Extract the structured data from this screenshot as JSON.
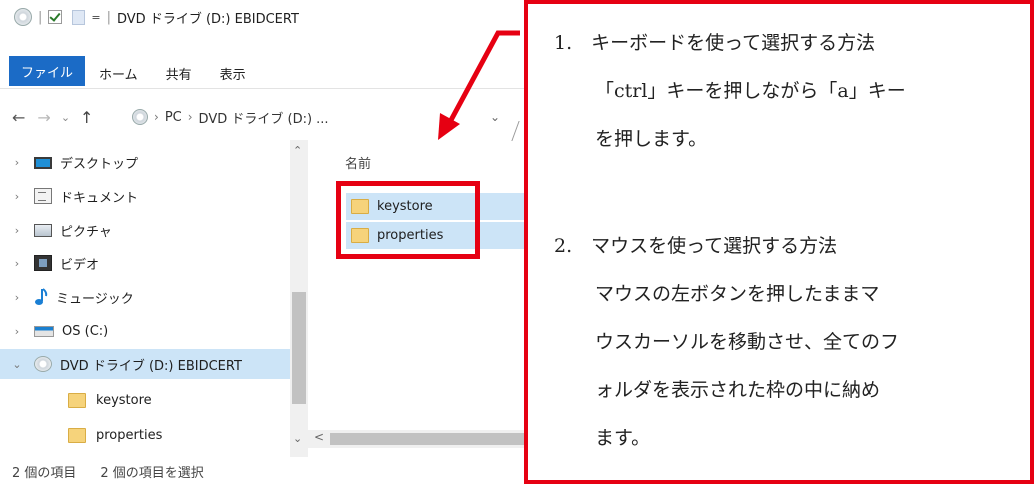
{
  "titlebar": {
    "title": "DVD ドライブ (D:) EBIDCERT",
    "sep": "|",
    "qa_arrow": "=",
    "icons": [
      "dvd-drive-icon",
      "properties-check-icon",
      "new-folder-icon",
      "customize-arrow-icon"
    ]
  },
  "ribbon": {
    "tabs": [
      "ファイル",
      "ホーム",
      "共有",
      "表示"
    ],
    "file_tab_color": "#1b6bc6"
  },
  "address": {
    "back": "←",
    "forward": "→",
    "recent": "⌄",
    "up": "↑",
    "chevron": "›",
    "crumbs": [
      "PC",
      "DVD ドライブ (D:) ..."
    ],
    "dropdown": "⌄"
  },
  "navpane": {
    "items": [
      {
        "label": "デスクトップ",
        "icon": "desktop-icon",
        "expander": "›"
      },
      {
        "label": "ドキュメント",
        "icon": "documents-icon",
        "expander": "›"
      },
      {
        "label": "ピクチャ",
        "icon": "pictures-icon",
        "expander": "›"
      },
      {
        "label": "ビデオ",
        "icon": "videos-icon",
        "expander": "›"
      },
      {
        "label": "ミュージック",
        "icon": "music-icon",
        "expander": "›"
      },
      {
        "label": "OS (C:)",
        "icon": "os-drive-icon",
        "expander": "›"
      },
      {
        "label": "DVD ドライブ (D:) EBIDCERT",
        "icon": "dvd-drive-icon",
        "expander": "⌄",
        "selected": true
      },
      {
        "label": "keystore",
        "icon": "folder-icon",
        "child": true
      },
      {
        "label": "properties",
        "icon": "folder-icon",
        "child": true
      }
    ]
  },
  "scroll": {
    "up": "⌃",
    "down": "⌄",
    "left": "<"
  },
  "content": {
    "column_name": "名前",
    "files": [
      "keystore",
      "properties"
    ],
    "selection_color": "#cce4f7"
  },
  "status": {
    "count": "2 個の項目",
    "selected": "2 個の項目を選択"
  },
  "callout": {
    "accent": "#e60012",
    "lines": [
      "1.　キーボードを使って選択する方法",
      "「ctrl」キーを押しながら「a」キー",
      "を押します。",
      "2.　マウスを使って選択する方法",
      "マウスの左ボタンを押したままマ",
      "ウスカーソルを移動させ、全てのフ",
      "ォルダを表示された枠の中に納め",
      "ます。"
    ]
  }
}
